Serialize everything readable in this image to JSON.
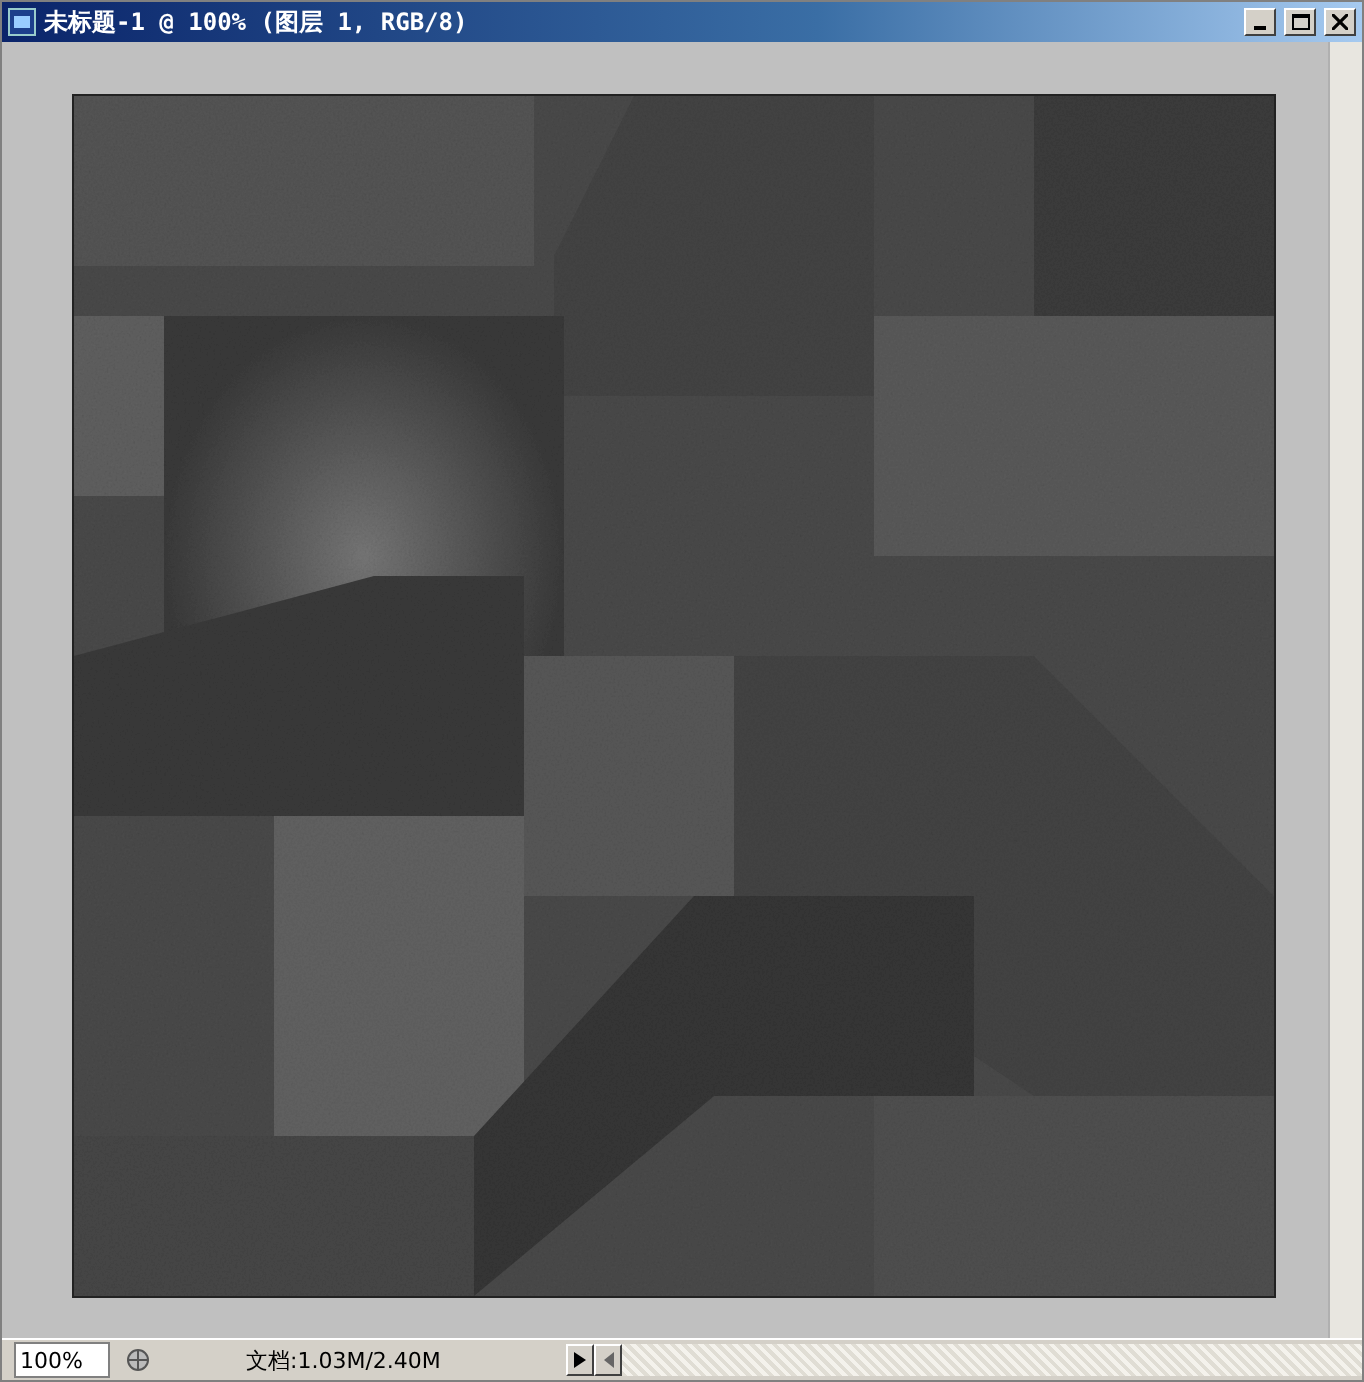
{
  "window": {
    "title": "未标题-1 @ 100% (图层 1, RGB/8)"
  },
  "status_bar": {
    "zoom": "100%",
    "document_info": "文档:1.03M/2.40M"
  }
}
